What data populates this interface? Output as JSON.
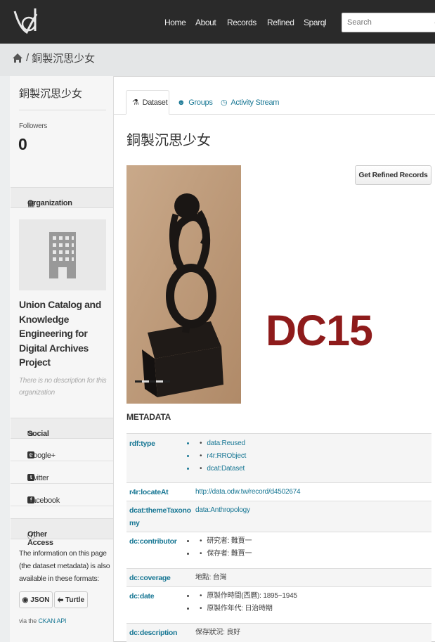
{
  "nav": {
    "items": [
      "Home",
      "About",
      "Records",
      "Refined",
      "Sparql"
    ],
    "search_placeholder": "Search"
  },
  "breadcrumb": {
    "current": "銅製沉思少女"
  },
  "sidebar": {
    "title": "銅製沉思少女",
    "followers_label": "Followers",
    "followers_count": "0",
    "organization_heading": "Organization",
    "org_name": "Union Catalog and Knowledge Engineering for Digital Archives Project",
    "org_desc": "There is no description for this organization",
    "social_heading": "Social",
    "social": [
      "Google+",
      "Twitter",
      "Facebook"
    ],
    "other_access_heading": "Other Access",
    "other_access_text": "The information on this page (the dataset metadata) is also available in these formats:",
    "json_label": "JSON",
    "turtle_label": "Turtle",
    "via_prefix": "via the",
    "via_link": "CKAN API"
  },
  "tabs": {
    "dataset": "Dataset",
    "groups": "Groups",
    "activity": "Activity Stream"
  },
  "dataset": {
    "title": "銅製沉思少女",
    "refined_button": "Get Refined Records",
    "overlay_label": "DC15",
    "metadata_heading": "METADATA"
  },
  "metadata": [
    {
      "key": "rdf:type",
      "values": [
        "data:Reused",
        "r4r:RRObject",
        "dcat:Dataset"
      ],
      "list": true,
      "plain": false
    },
    {
      "key": "r4r:locateAt",
      "value": "http://data.odw.tw/record/d4502674",
      "list": false,
      "plain": false
    },
    {
      "key": "dcat:themeTaxonomy",
      "value": "data:Anthropology",
      "list": false,
      "plain": false
    },
    {
      "key": "dc:contributor",
      "values": [
        "研究者: 難賈一",
        "保存者: 難賈一"
      ],
      "list": true,
      "plain": true
    },
    {
      "key": "dc:coverage",
      "value": "地點: 台灣",
      "list": false,
      "plain": true
    },
    {
      "key": "dc:date",
      "values": [
        "原製作時間(西曆): 1895~1945",
        "原製作年代: 日治時期"
      ],
      "list": true,
      "plain": true
    },
    {
      "key": "dc:description",
      "value": "保存狀況: 良好",
      "list": false,
      "plain": true
    }
  ],
  "colors": {
    "topnav": "#2a2a2a",
    "link": "#187794",
    "overlay": "#8e1b1b"
  }
}
